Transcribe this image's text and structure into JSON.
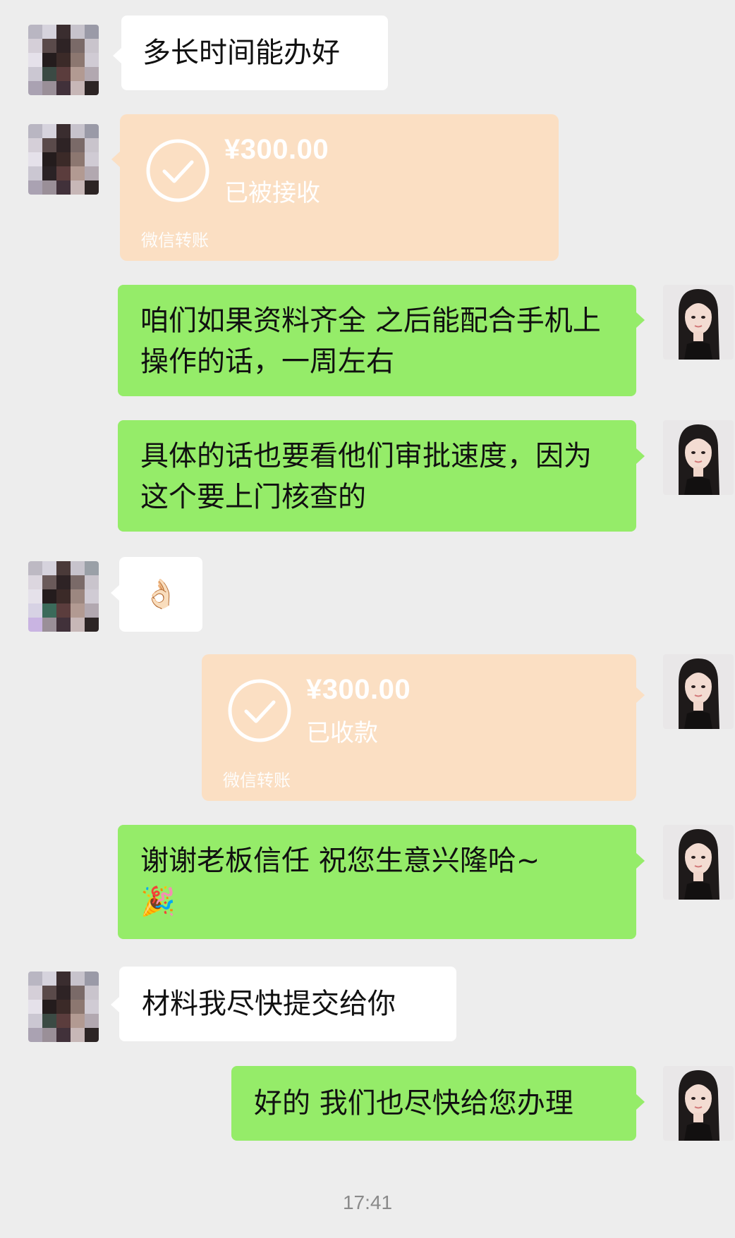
{
  "messages": [
    {
      "text": "多长时间能办好"
    },
    {
      "amount": "¥300.00",
      "status": "已被接收",
      "brand": "微信转账"
    },
    {
      "text": "咱们如果资料齐全 之后能配合手机上操作的话，一周左右"
    },
    {
      "text": "具体的话也要看他们审批速度，因为这个要上门核查的"
    },
    {
      "emoji": "👌🏻"
    },
    {
      "amount": "¥300.00",
      "status": "已收款",
      "brand": "微信转账"
    },
    {
      "text": "谢谢老板信任  祝您生意兴隆哈~",
      "emoji": "🎉"
    },
    {
      "text": "材料我尽快提交给你"
    },
    {
      "text": "好的 我们也尽快给您办理"
    }
  ],
  "timestamp": "17:41",
  "colors": {
    "background": "#ededed",
    "green_bubble": "#95ec69",
    "white_bubble": "#ffffff",
    "transfer_bubble": "#fbdfc3"
  },
  "icons": {
    "transfer_check": "check-circle-icon",
    "contact_avatar": "pixelated-avatar",
    "self_avatar": "portrait-avatar"
  }
}
